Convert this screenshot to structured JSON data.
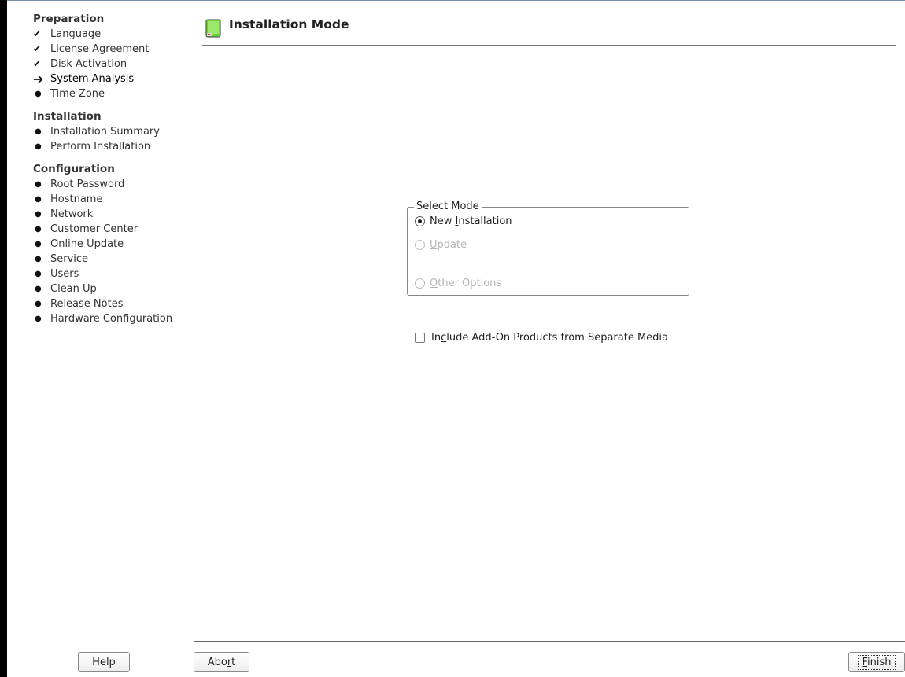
{
  "sidebar": {
    "sections": [
      {
        "title": "Preparation",
        "steps": [
          {
            "label": "Language",
            "status": "done"
          },
          {
            "label": "License Agreement",
            "status": "done"
          },
          {
            "label": "Disk Activation",
            "status": "done"
          },
          {
            "label": "System Analysis",
            "status": "current"
          },
          {
            "label": "Time Zone",
            "status": "pending"
          }
        ]
      },
      {
        "title": "Installation",
        "steps": [
          {
            "label": "Installation Summary",
            "status": "pending"
          },
          {
            "label": "Perform Installation",
            "status": "pending"
          }
        ]
      },
      {
        "title": "Configuration",
        "steps": [
          {
            "label": "Root Password",
            "status": "pending"
          },
          {
            "label": "Hostname",
            "status": "pending"
          },
          {
            "label": "Network",
            "status": "pending"
          },
          {
            "label": "Customer Center",
            "status": "pending"
          },
          {
            "label": "Online Update",
            "status": "pending"
          },
          {
            "label": "Service",
            "status": "pending"
          },
          {
            "label": "Users",
            "status": "pending"
          },
          {
            "label": "Clean Up",
            "status": "pending"
          },
          {
            "label": "Release Notes",
            "status": "pending"
          },
          {
            "label": "Hardware Configuration",
            "status": "pending"
          }
        ]
      }
    ]
  },
  "page": {
    "title": "Installation Mode",
    "icon": "installation-mode-icon"
  },
  "select_mode": {
    "legend": "Select Mode",
    "options": [
      {
        "pre": "New ",
        "key": "I",
        "post": "nstallation",
        "checked": true,
        "enabled": true
      },
      {
        "pre": "",
        "key": "U",
        "post": "pdate",
        "checked": false,
        "enabled": false
      },
      {
        "pre": "",
        "key": "O",
        "post": "ther Options",
        "checked": false,
        "enabled": false
      }
    ]
  },
  "addon": {
    "pre": "In",
    "key": "c",
    "post": "lude Add-On Products from Separate Media",
    "checked": false
  },
  "buttons": {
    "help": "Help",
    "abort": {
      "pre": "Abo",
      "key": "r",
      "post": "t"
    },
    "finish": {
      "pre": "",
      "key": "F",
      "post": "inish"
    }
  },
  "colors": {
    "accent": "#6fd13a",
    "disabled_text": "#b5b5b5"
  }
}
